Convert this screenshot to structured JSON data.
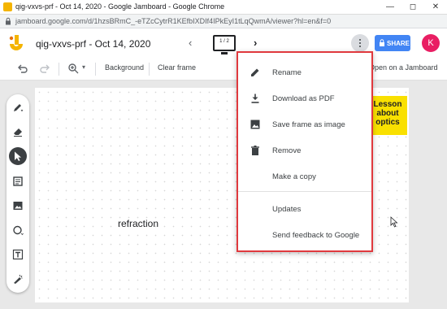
{
  "window": {
    "title": "qig-vxvs-prf - Oct 14, 2020 - Google Jamboard - Google Chrome",
    "url": "jamboard.google.com/d/1hzsBRmC_-eTZcCytrR1KEfbIXDIf4IPkEyI1tLqQwmA/viewer?hl=en&f=0"
  },
  "app": {
    "doc_name": "qig-vxvs-prf - Oct 14, 2020",
    "frame_indicator": "1 / 2",
    "share_label": "SHARE",
    "avatar_initial": "K",
    "accent": "#4285f4",
    "avatar_color": "#e91e63"
  },
  "toolbar": {
    "background_label": "Background",
    "clear_frame_label": "Clear frame",
    "open_jamboard_label": "Open on a Jamboard"
  },
  "canvas": {
    "text": "refraction",
    "sticky_lines": [
      "Lesson",
      "about",
      "optics"
    ],
    "sticky_color": "#f9e000"
  },
  "menu": {
    "highlight_color": "#e0393e",
    "items": [
      {
        "label": "Rename",
        "icon": "pencil-icon"
      },
      {
        "label": "Download as PDF",
        "icon": "download-icon"
      },
      {
        "label": "Save frame as image",
        "icon": "image-icon"
      },
      {
        "label": "Remove",
        "icon": "trash-icon"
      },
      {
        "label": "Make a copy",
        "icon": ""
      },
      {
        "label": "Updates",
        "icon": ""
      },
      {
        "label": "Send feedback to Google",
        "icon": ""
      }
    ]
  },
  "sidebar": {
    "tools": [
      "pen-icon",
      "eraser-icon",
      "select-icon",
      "sticky-note-icon",
      "add-image-icon",
      "circle-icon",
      "text-box-icon",
      "laser-icon"
    ],
    "active_tool": "select-icon"
  }
}
